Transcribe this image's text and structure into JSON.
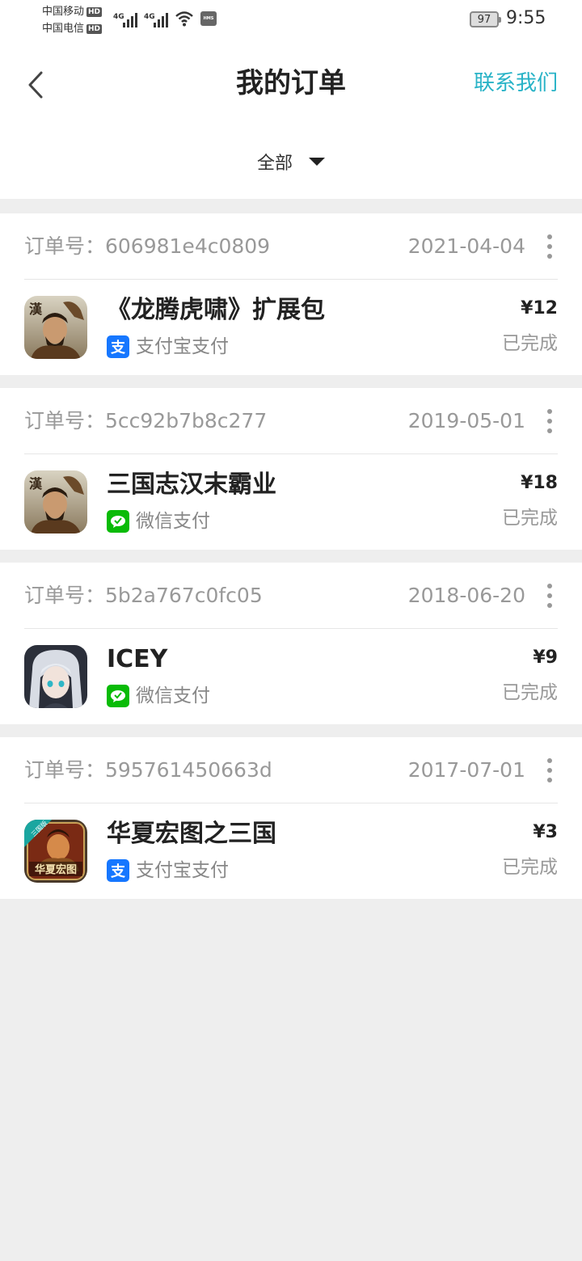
{
  "status_bar": {
    "carrier1": "中国移动",
    "carrier2": "中国电信",
    "hd": "HD",
    "net_tag": "4G",
    "hms": "HMS",
    "battery": "97",
    "time": "9:55"
  },
  "header": {
    "title": "我的订单",
    "contact_label": "联系我们",
    "filter_label": "全部"
  },
  "colors": {
    "accent": "#29b3c7",
    "alipay": "#1677ff",
    "wechat": "#09bb07"
  },
  "orders": [
    {
      "order_no": "订单号：606981e4c0809",
      "date": "2021-04-04",
      "product": "《龙腾虎啸》扩展包",
      "pay_method": "支付宝支付",
      "pay_icon": "alipay-icon",
      "price": "¥12",
      "status": "已完成",
      "app_icon": "sanguo-warlord-icon"
    },
    {
      "order_no": "订单号：5cc92b7b8c277",
      "date": "2019-05-01",
      "product": "三国志汉末霸业",
      "pay_method": "微信支付",
      "pay_icon": "wechat-pay-icon",
      "price": "¥18",
      "status": "已完成",
      "app_icon": "sanguo-warlord-icon"
    },
    {
      "order_no": "订单号：5b2a767c0fc05",
      "date": "2018-06-20",
      "product": "ICEY",
      "pay_method": "微信支付",
      "pay_icon": "wechat-pay-icon",
      "price": "¥9",
      "status": "已完成",
      "app_icon": "icey-girl-icon"
    },
    {
      "order_no": "订单号：595761450663d",
      "date": "2017-07-01",
      "product": "华夏宏图之三国",
      "pay_method": "支付宝支付",
      "pay_icon": "alipay-icon",
      "price": "¥3",
      "status": "已完成",
      "app_icon": "huaxia-hongtu-icon",
      "app_icon_text": "华夏宏图",
      "app_icon_ribbon": "三国版"
    }
  ]
}
